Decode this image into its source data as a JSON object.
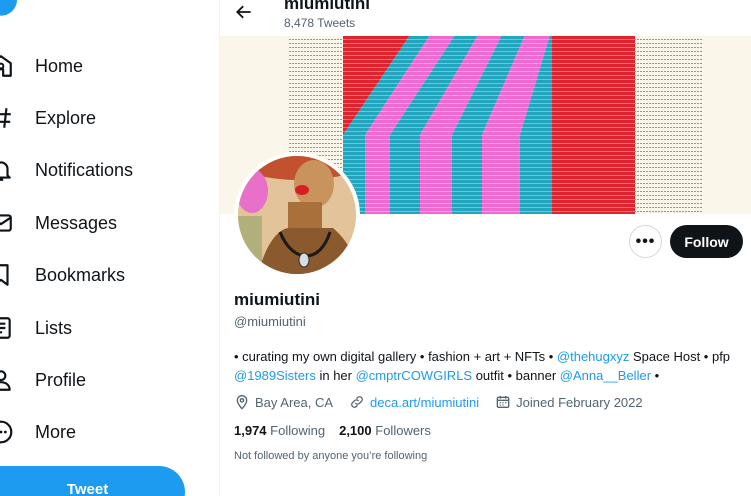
{
  "sidebar": {
    "items": [
      {
        "label": "Home",
        "icon": "home-icon"
      },
      {
        "label": "Explore",
        "icon": "hashtag-icon"
      },
      {
        "label": "Notifications",
        "icon": "bell-icon"
      },
      {
        "label": "Messages",
        "icon": "envelope-icon"
      },
      {
        "label": "Bookmarks",
        "icon": "bookmark-icon"
      },
      {
        "label": "Lists",
        "icon": "list-icon"
      },
      {
        "label": "Profile",
        "icon": "person-icon"
      },
      {
        "label": "More",
        "icon": "more-circle-icon"
      }
    ],
    "tweet_button": "Tweet"
  },
  "header": {
    "name": "miumiutini",
    "tweet_count": "8,478 Tweets"
  },
  "profile": {
    "name": "miumiutini",
    "handle": "@miumiutini",
    "bio": {
      "t1": "• curating my own digital gallery • fashion + art + NFTs • ",
      "l1": "@thehugxyz",
      "t2": " Space Host • pfp ",
      "l2": "@1989Sisters",
      "t3": " in her ",
      "l3": "@cmptrCOWGIRLS",
      "t4": " outfit • banner ",
      "l4": "@Anna__Beller",
      "t5": " •"
    },
    "location": "Bay Area, CA",
    "website": "deca.art/miumiutini",
    "joined": "Joined February 2022",
    "following_count": "1,974",
    "following_label": "Following",
    "followers_count": "2,100",
    "followers_label": "Followers",
    "not_followed": "Not followed by anyone you’re following"
  },
  "actions": {
    "more": "•••",
    "follow": "Follow"
  },
  "colors": {
    "accent": "#1d9bf0",
    "text": "#0f1419",
    "secondary": "#536471",
    "follow_bg": "#0f1419"
  }
}
